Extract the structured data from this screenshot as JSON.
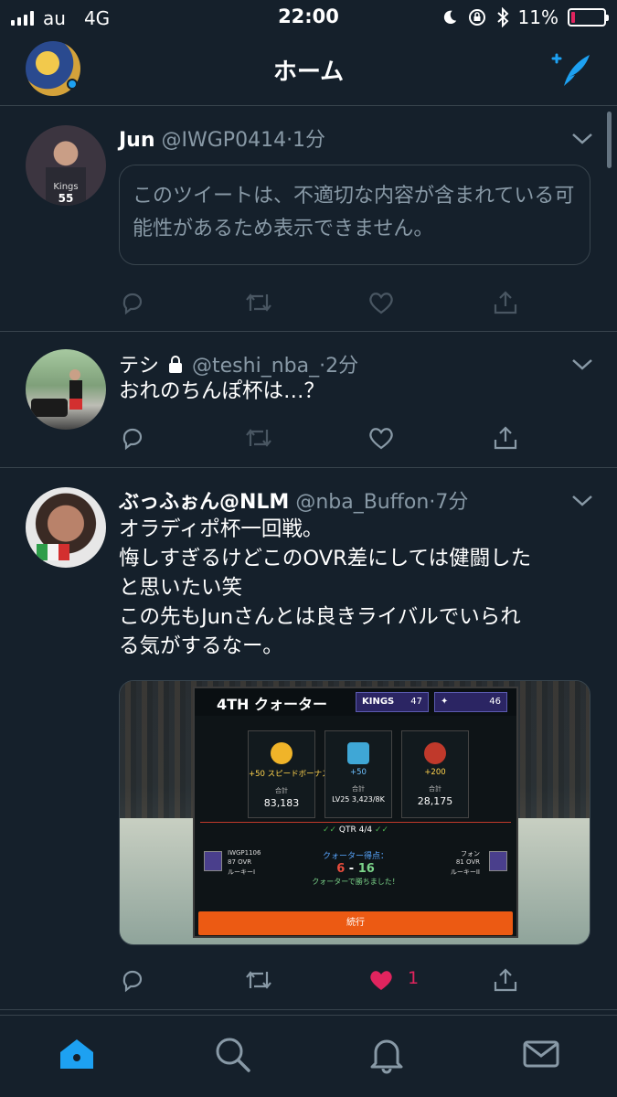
{
  "status_bar": {
    "carrier": "au",
    "network": "4G",
    "time": "22:00",
    "battery": "11%",
    "battery_level": 0.11
  },
  "header": {
    "title": "ホーム"
  },
  "tweets": [
    {
      "name": "Jun",
      "handle": "@IWGP0414",
      "time": "·1分",
      "withheld_text": "このツイートは、不適切な内容が含まれている可能性があるため表示できません。"
    },
    {
      "name": "テシ",
      "handle": "@teshi_nba_",
      "time": "·2分",
      "text": "おれのちんぽ杯は…？"
    },
    {
      "name": "ぶっふぉん@NLM",
      "handle": "@nba_Buffon",
      "time": "·7分",
      "text_lines": [
        "オラディポ杯一回戦。",
        "悔しすぎるけどこのOVR差にしては健闘した",
        "と思いたい笑",
        "この先もJunさんとは良きライバルでいられ",
        "る気がするなー。"
      ],
      "like_count": "1",
      "media": {
        "quarter_title": "4TH クォーター",
        "team1_logo": "KINGS",
        "team1_score": "47",
        "team2_score": "46",
        "card1_bonus": "+50 スピードボーナス",
        "card1_label": "合計",
        "card1_value": "83,183",
        "card2_bonus": "+50",
        "card2_level": "LV25",
        "card2_label": "合計",
        "card2_value": "3,423/8K",
        "card3_bonus": "+200",
        "card3_label": "合計",
        "card3_value": "28,175",
        "qtr": "QTR 4/4",
        "player1_name": "IWGP1106",
        "player1_ovr": "87 OVR",
        "player1_rank": "ルーキーI",
        "player2_name": "フォン",
        "player2_ovr": "81 OVR",
        "player2_rank": "ルーキーII",
        "score_label": "クォーター得点：",
        "score_left": "6",
        "score_sep": "-",
        "score_right": "16",
        "result": "クォーターで勝ちました！",
        "continue_button": "続行"
      }
    }
  ]
}
